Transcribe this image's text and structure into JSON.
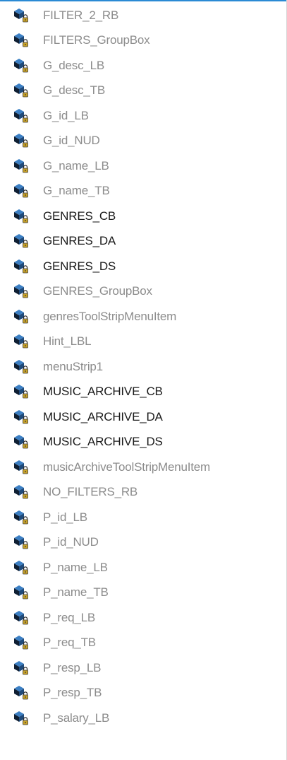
{
  "accent_color": "#2a8ad4",
  "icon": "field-with-lock-icon",
  "colors": {
    "private_text": "#8c8c8c",
    "public_text": "#1a1a1a"
  },
  "members": [
    {
      "label": "FILTER_2_RB",
      "access": "private"
    },
    {
      "label": "FILTERS_GroupBox",
      "access": "private"
    },
    {
      "label": "G_desc_LB",
      "access": "private"
    },
    {
      "label": "G_desc_TB",
      "access": "private"
    },
    {
      "label": "G_id_LB",
      "access": "private"
    },
    {
      "label": "G_id_NUD",
      "access": "private"
    },
    {
      "label": "G_name_LB",
      "access": "private"
    },
    {
      "label": "G_name_TB",
      "access": "private"
    },
    {
      "label": "GENRES_CB",
      "access": "public"
    },
    {
      "label": "GENRES_DA",
      "access": "public"
    },
    {
      "label": "GENRES_DS",
      "access": "public"
    },
    {
      "label": "GENRES_GroupBox",
      "access": "private"
    },
    {
      "label": "genresToolStripMenuItem",
      "access": "private"
    },
    {
      "label": "Hint_LBL",
      "access": "private"
    },
    {
      "label": "menuStrip1",
      "access": "private"
    },
    {
      "label": "MUSIC_ARCHIVE_CB",
      "access": "public"
    },
    {
      "label": "MUSIC_ARCHIVE_DA",
      "access": "public"
    },
    {
      "label": "MUSIC_ARCHIVE_DS",
      "access": "public"
    },
    {
      "label": "musicArchiveToolStripMenuItem",
      "access": "private"
    },
    {
      "label": "NO_FILTERS_RB",
      "access": "private"
    },
    {
      "label": "P_id_LB",
      "access": "private"
    },
    {
      "label": "P_id_NUD",
      "access": "private"
    },
    {
      "label": "P_name_LB",
      "access": "private"
    },
    {
      "label": "P_name_TB",
      "access": "private"
    },
    {
      "label": "P_req_LB",
      "access": "private"
    },
    {
      "label": "P_req_TB",
      "access": "private"
    },
    {
      "label": "P_resp_LB",
      "access": "private"
    },
    {
      "label": "P_resp_TB",
      "access": "private"
    },
    {
      "label": "P_salary_LB",
      "access": "private"
    }
  ]
}
